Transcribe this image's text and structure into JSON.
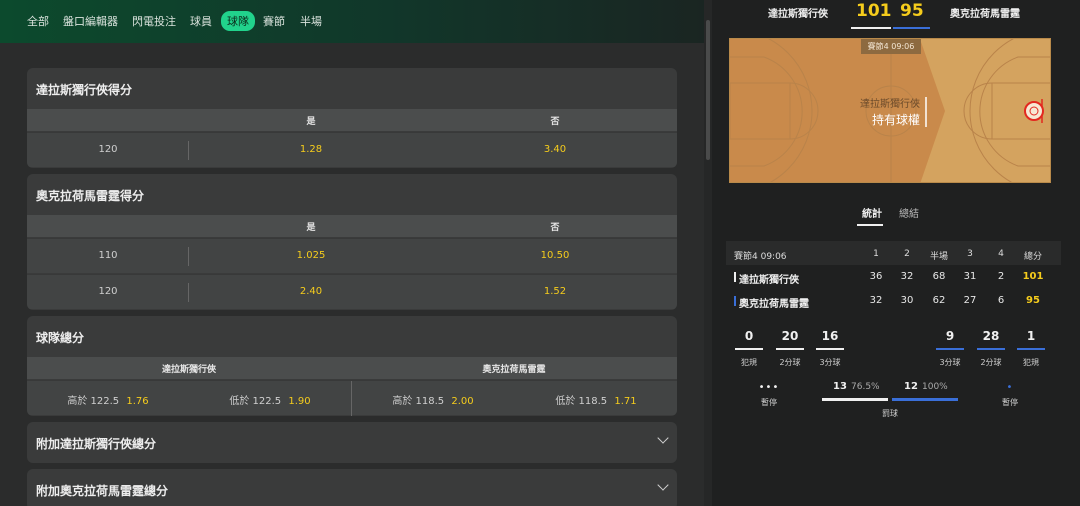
{
  "nav": {
    "tabs": [
      "全部",
      "盤口編輯器",
      "閃電投注",
      "球員",
      "球隊",
      "賽節",
      "半場"
    ],
    "active": "球隊"
  },
  "markets": [
    {
      "title": "達拉斯獨行俠得分",
      "yes": "是",
      "no": "否",
      "rows": [
        {
          "line": "120",
          "yes": "1.28",
          "no": "3.40"
        }
      ]
    },
    {
      "title": "奧克拉荷馬雷霆得分",
      "yes": "是",
      "no": "否",
      "rows": [
        {
          "line": "110",
          "yes": "1.025",
          "no": "10.50"
        },
        {
          "line": "120",
          "yes": "2.40",
          "no": "1.52"
        }
      ]
    },
    {
      "title": "球隊總分",
      "team1": "達拉斯獨行俠",
      "team2": "奧克拉荷馬雷霆",
      "cells": [
        {
          "label": "高於 122.5",
          "odd": "1.76"
        },
        {
          "label": "低於 122.5",
          "odd": "1.90"
        },
        {
          "label": "高於 118.5",
          "odd": "2.00"
        },
        {
          "label": "低於 118.5",
          "odd": "1.71"
        }
      ]
    },
    {
      "title": "附加達拉斯獨行俠總分"
    },
    {
      "title": "附加奧克拉荷馬雷霆總分"
    }
  ],
  "scoreboard": {
    "home": "達拉斯獨行俠",
    "home_score": "101",
    "away": "奧克拉荷馬雷霆",
    "away_score": "95",
    "home_color": "#f0f0f0",
    "away_color": "#3a6fd8"
  },
  "court": {
    "clock": "賽節4 09:06",
    "possession_team": "達拉斯獨行俠",
    "possession_label": "持有球權"
  },
  "stats_tabs": {
    "active": "統計",
    "other": "總結"
  },
  "period_table": {
    "clock": "賽節4 09:06",
    "headers": [
      "1",
      "2",
      "半場",
      "3",
      "4",
      "總分"
    ],
    "teams": [
      {
        "name": "達拉斯獨行俠",
        "scores": [
          "36",
          "32",
          "68",
          "31",
          "2",
          "101"
        ]
      },
      {
        "name": "奧克拉荷馬雷霆",
        "scores": [
          "32",
          "30",
          "62",
          "27",
          "6",
          "95"
        ]
      }
    ]
  },
  "team_stats": {
    "home": [
      {
        "value": "0",
        "label": "犯規"
      },
      {
        "value": "20",
        "label": "2分球"
      },
      {
        "value": "16",
        "label": "3分球"
      }
    ],
    "away": [
      {
        "value": "9",
        "label": "3分球"
      },
      {
        "value": "28",
        "label": "2分球"
      },
      {
        "value": "1",
        "label": "犯規"
      }
    ],
    "timeouts_label": "暫停",
    "free_throws": {
      "label": "罰球",
      "home": "13",
      "home_pct": "76.5%",
      "away": "12",
      "away_pct": "100%"
    }
  }
}
